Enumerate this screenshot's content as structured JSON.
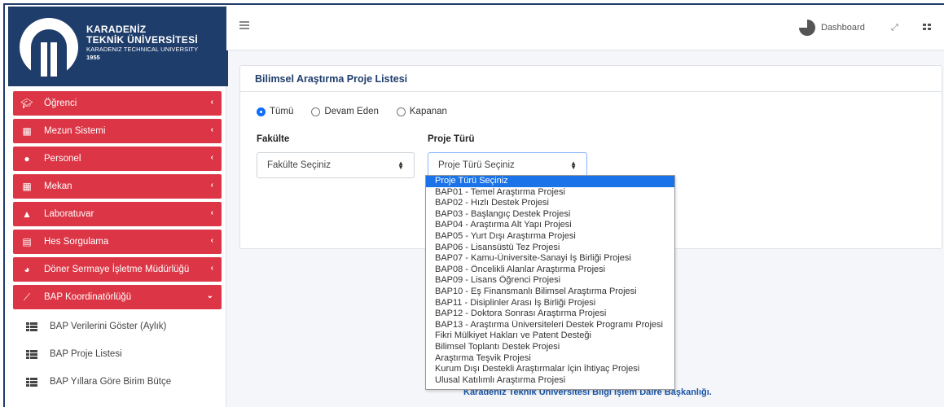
{
  "logo": {
    "line1": "KARADENİZ",
    "line2": "TEKNİK ÜNİVERSİTESİ",
    "line3": "KARADENIZ TECHNICAL UNIVERSITY",
    "line4": "1955"
  },
  "sidebar": {
    "items": [
      {
        "label": "Öğrenci",
        "icon": "graduation-cap-icon",
        "chevron": "‹"
      },
      {
        "label": "Mezun Sistemi",
        "icon": "building-icon",
        "chevron": "‹"
      },
      {
        "label": "Personel",
        "icon": "users-icon",
        "chevron": "‹"
      },
      {
        "label": "Mekan",
        "icon": "building-icon",
        "chevron": "‹"
      },
      {
        "label": "Laboratuvar",
        "icon": "flask-icon",
        "chevron": "‹"
      },
      {
        "label": "Hes Sorgulama",
        "icon": "id-card-icon",
        "chevron": "‹"
      },
      {
        "label": "Döner Sermaye İşletme Müdürlüğü",
        "icon": "pie-chart-icon",
        "chevron": "‹"
      },
      {
        "label": "BAP Koordinatörlüğü",
        "icon": "line-chart-icon",
        "chevron": "⌄"
      }
    ],
    "subitems": [
      {
        "label": "BAP Verilerini Göster (Aylık)",
        "icon": "list-icon"
      },
      {
        "label": "BAP Proje Listesi",
        "icon": "list-icon"
      },
      {
        "label": "BAP Yıllara Göre Birim Bütçe",
        "icon": "list-icon"
      }
    ]
  },
  "topbar": {
    "dashboard_label": "Dashboard",
    "menu_icon": "hamburger-icon",
    "expand_icon": "expand-icon",
    "grid_icon": "grid-icon"
  },
  "card": {
    "title": "Bilimsel Araştırma Proje Listesi",
    "radios": [
      {
        "label": "Tümü",
        "checked": true
      },
      {
        "label": "Devam Eden",
        "checked": false
      },
      {
        "label": "Kapanan",
        "checked": false
      }
    ],
    "fakulte_label": "Fakülte",
    "fakulte_value": "Fakülte Seçiniz",
    "proje_turu_label": "Proje Türü",
    "proje_turu_value": "Proje Türü Seçiniz"
  },
  "dropdown": {
    "options": [
      "Proje Türü Seçiniz",
      "BAP01 - Temel Araştırma Projesi",
      "BAP02 - Hızlı Destek Projesi",
      "BAP03 - Başlangıç Destek Projesi",
      "BAP04 - Araştırma Alt Yapı Projesi",
      "BAP05 - Yurt Dışı Araştırma Projesi",
      "BAP06 - Lisansüstü Tez Projesi",
      "BAP07 - Kamu-Üniversite-Sanayi İş Birliği Projesi",
      "BAP08 - Öncelikli Alanlar Araştırma Projesi",
      "BAP09 - Lisans Öğrenci Projesi",
      "BAP10 - Eş Finansmanlı Bilimsel Araştırma Projesi",
      "BAP11 - Disiplinler Arası İş Birliği Projesi",
      "BAP12 - Doktora Sonrası Araştırma Projesi",
      "BAP13 - Araştırma Üniversiteleri Destek Programı Projesi",
      "Fikri Mülkiyet Hakları ve Patent Desteği",
      "Bilimsel Toplantı Destek Projesi",
      "Araştırma Teşvik Projesi",
      "Kurum Dışı Destekli Araştırmalar İçin İhtiyaç Projesi",
      "Ulusal Katılımlı Araştırma Projesi"
    ]
  },
  "footer": {
    "text": "Karadeniz Teknik Üniversitesi Bilgi İşlem Daire Başkanlığı."
  }
}
